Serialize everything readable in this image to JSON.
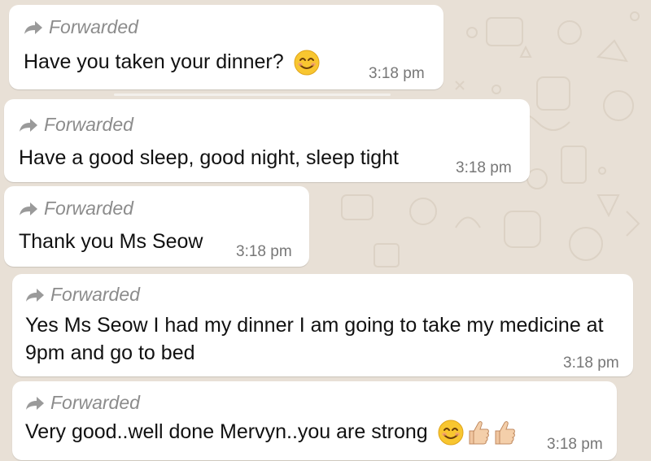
{
  "chat": {
    "messages": [
      {
        "forwarded_label": "Forwarded",
        "text": "Have you taken your dinner?",
        "emoji": [
          "smiling-face-icon"
        ],
        "time": "3:18 pm"
      },
      {
        "forwarded_label": "Forwarded",
        "text": "Have a good sleep, good night, sleep tight",
        "emoji": [],
        "time": "3:18 pm"
      },
      {
        "forwarded_label": "Forwarded",
        "text": "Thank you Ms Seow",
        "emoji": [],
        "time": "3:18 pm"
      },
      {
        "forwarded_label": "Forwarded",
        "text_line1": "Yes Ms Seow I had my dinner I am going to take my medicine at",
        "text_line2": "9pm and go to bed",
        "emoji": [],
        "time": "3:18 pm"
      },
      {
        "forwarded_label": "Forwarded",
        "text": "Very good..well done Mervyn..you are strong",
        "emoji": [
          "smiling-face-icon",
          "thumbs-up-icon",
          "thumbs-up-icon"
        ],
        "time": "3:18 pm"
      }
    ]
  },
  "colors": {
    "wallpaper": "#e8e0d6",
    "bubble": "#ffffff",
    "forwarded_text": "#8c8c8c",
    "message_text": "#111111",
    "timestamp": "#777777"
  }
}
